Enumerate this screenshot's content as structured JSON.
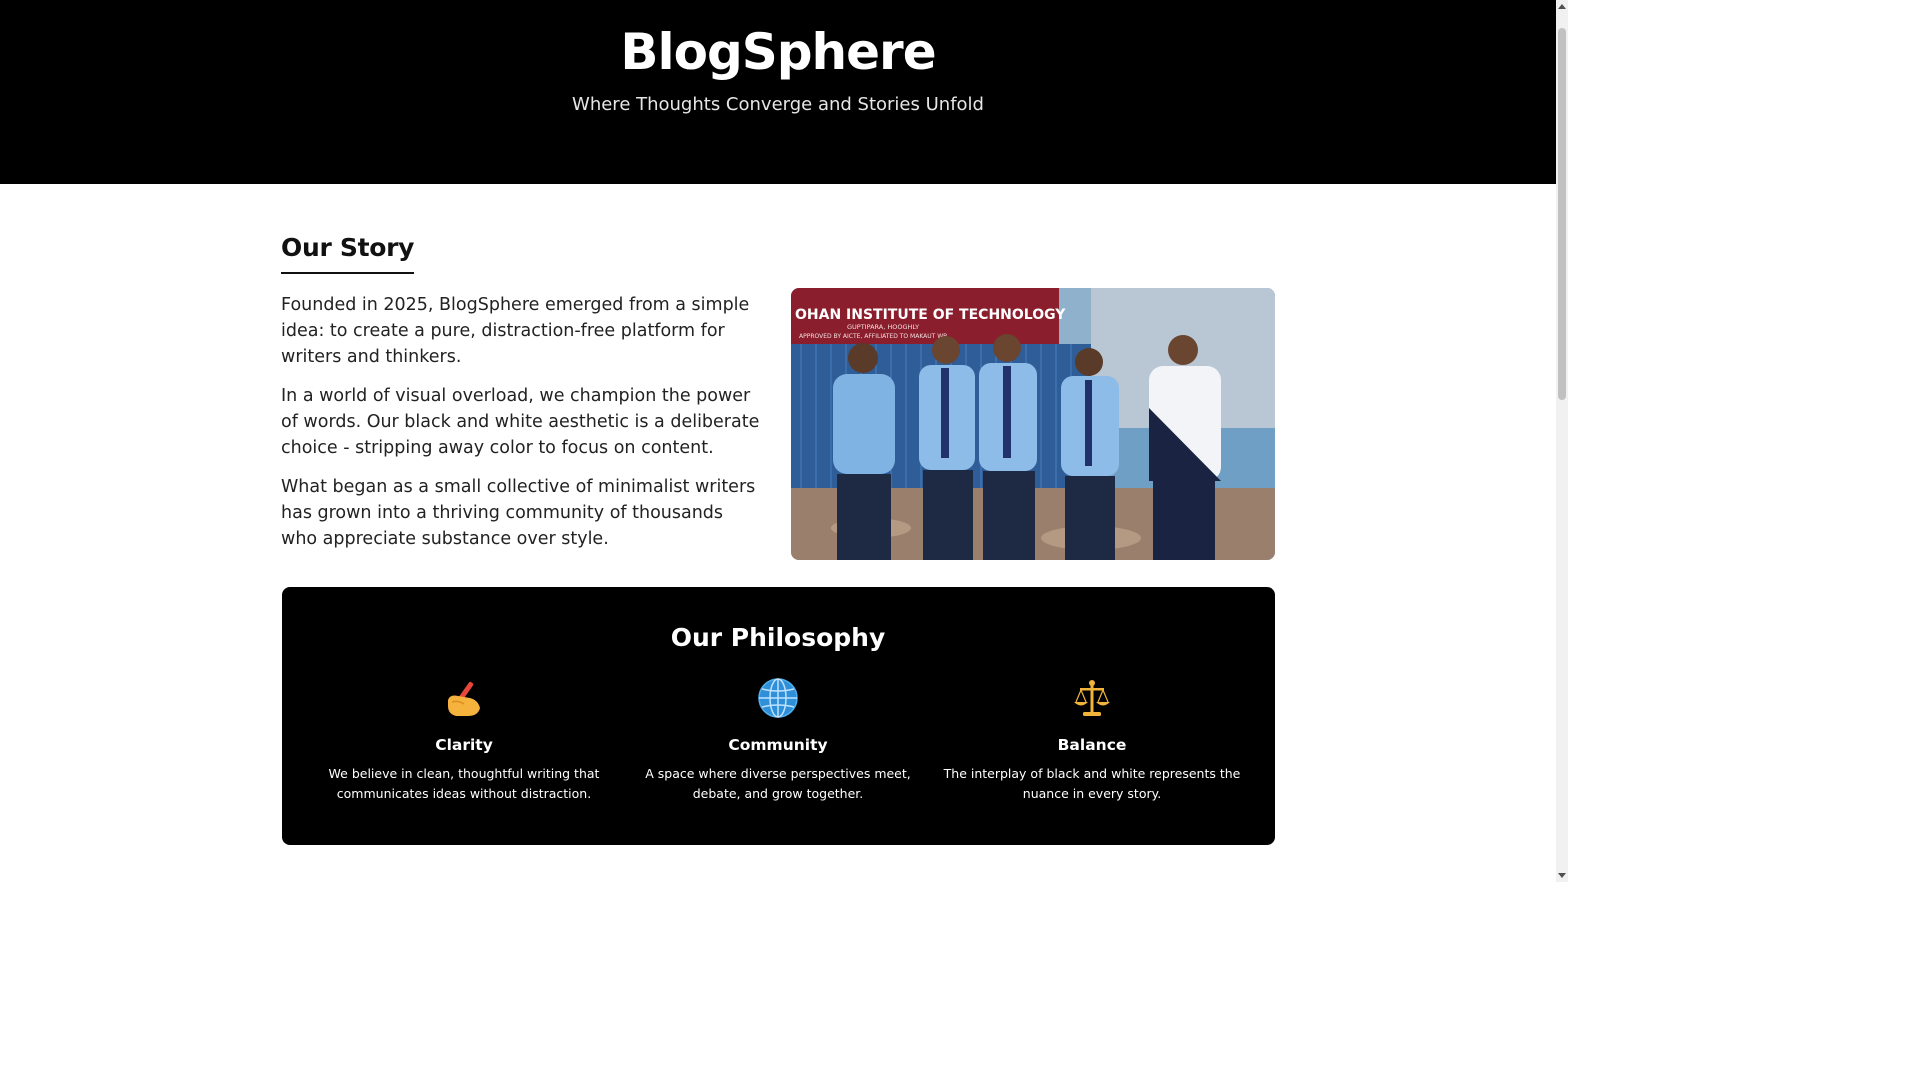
{
  "header": {
    "title": "BlogSphere",
    "tagline": "Where Thoughts Converge and Stories Unfold"
  },
  "story": {
    "heading": "Our Story",
    "paragraphs": [
      "Founded in 2025, BlogSphere emerged from a simple idea: to create a pure, distraction-free platform for writers and thinkers.",
      "In a world of visual overload, we champion the power of words. Our black and white aesthetic is a deliberate choice - stripping away color to focus on content.",
      "What began as a small collective of minimalist writers has grown into a thriving community of thousands who appreciate substance over style."
    ],
    "photo": {
      "icon": "team-photo",
      "sign_text": "OHAN INSTITUTE OF TECHNOLOGY",
      "sign_subtext": "GUPTIPARA, HOOGHLY",
      "sign_subtext2": "APPROVED BY AICTE, AFFILIATED TO MAKAUT WB"
    }
  },
  "philosophy": {
    "title": "Our Philosophy",
    "pillars": [
      {
        "icon": "writing-hand-icon",
        "name": "Clarity",
        "description": "We believe in clean, thoughtful writing that communicates ideas without distraction."
      },
      {
        "icon": "globe-icon",
        "name": "Community",
        "description": "A space where diverse perspectives meet, debate, and grow together."
      },
      {
        "icon": "balance-scale-icon",
        "name": "Balance",
        "description": "The interplay of black and white represents the nuance in every story."
      }
    ]
  },
  "colors": {
    "background": "#ffffff",
    "header_bg": "#000000",
    "card_bg": "#000000",
    "text": "#111111"
  }
}
